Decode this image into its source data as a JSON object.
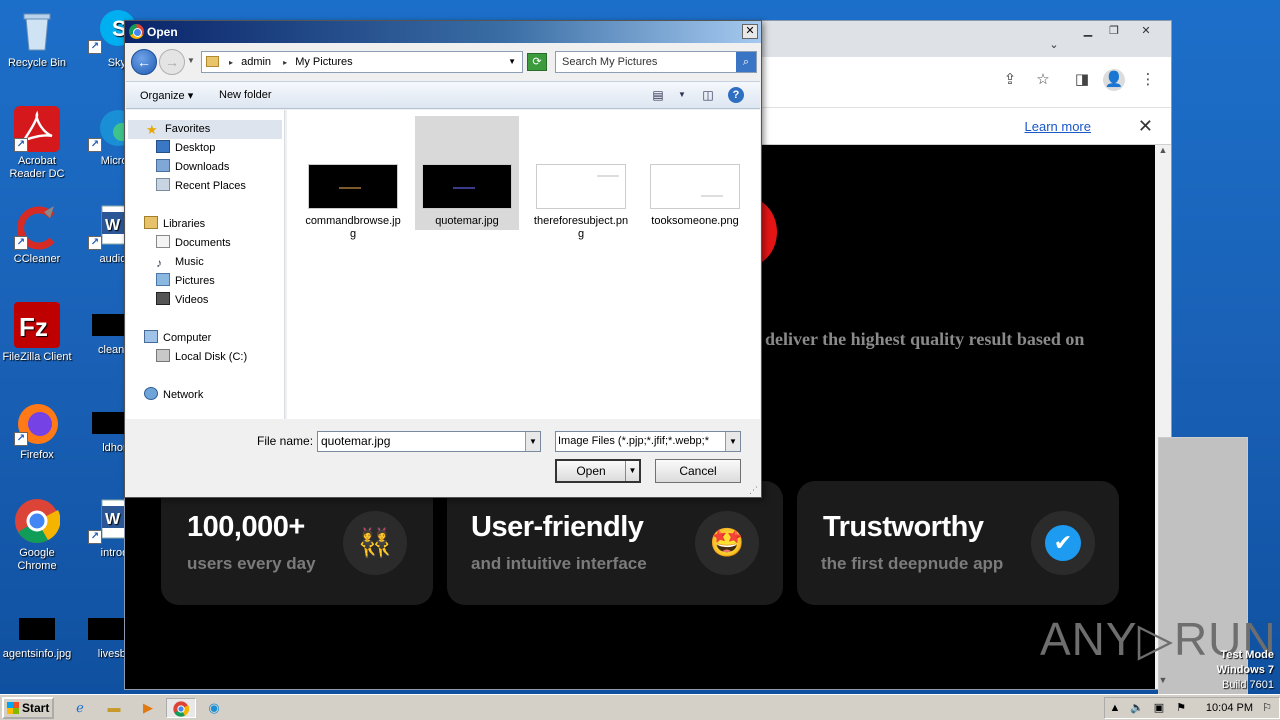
{
  "desktop": {
    "icons": [
      {
        "label": "Recycle Bin"
      },
      {
        "label": "Skype"
      },
      {
        "label": "Acrobat Reader DC"
      },
      {
        "label": "Microsoft"
      },
      {
        "label": "CCleaner"
      },
      {
        "label": "audiopolit"
      },
      {
        "label": "FileZilla Client"
      },
      {
        "label": "cleangrow"
      },
      {
        "label": "Firefox"
      },
      {
        "label": "ldhomes"
      },
      {
        "label": "Google Chrome"
      },
      {
        "label": "introducti"
      },
      {
        "label": "agentsinfo.jpg"
      },
      {
        "label": "livesbead"
      }
    ]
  },
  "browser": {
    "infobar_link": "Learn more",
    "page_text": "deliver the highest quality result based on",
    "cards": [
      {
        "title": "100,000+",
        "subtitle": "users every day",
        "emoji": "👯"
      },
      {
        "title": "User-friendly",
        "subtitle": "and intuitive interface",
        "emoji": "🤩"
      },
      {
        "title": "Trustworthy",
        "subtitle": "the first deepnude app",
        "emoji": "✔"
      }
    ],
    "watermark": "ANY▷RUN"
  },
  "dialog": {
    "title": "Open",
    "breadcrumb": [
      "admin",
      "My Pictures"
    ],
    "search_placeholder": "Search My Pictures",
    "organize_label": "Organize",
    "new_folder_label": "New folder",
    "nav": {
      "favorites": "Favorites",
      "desktop": "Desktop",
      "downloads": "Downloads",
      "recent": "Recent Places",
      "libraries": "Libraries",
      "documents": "Documents",
      "music": "Music",
      "pictures": "Pictures",
      "videos": "Videos",
      "computer": "Computer",
      "local_disk": "Local Disk (C:)",
      "network": "Network"
    },
    "files": [
      {
        "name": "commandbrowse.jpg",
        "thumb": "dark"
      },
      {
        "name": "quotemar.jpg",
        "thumb": "dark"
      },
      {
        "name": "thereforesubject.png",
        "thumb": "light"
      },
      {
        "name": "tooksomeone.png",
        "thumb": "light"
      }
    ],
    "file_name_label": "File name:",
    "file_name_value": "quotemar.jpg",
    "file_type_value": "Image Files (*.pjp;*.jfif;*.webp;*",
    "open_label": "Open",
    "cancel_label": "Cancel"
  },
  "system": {
    "test_mode": "Test Mode",
    "os": "Windows 7",
    "build": "Build 7601",
    "start_label": "Start",
    "clock": "10:04 PM"
  }
}
